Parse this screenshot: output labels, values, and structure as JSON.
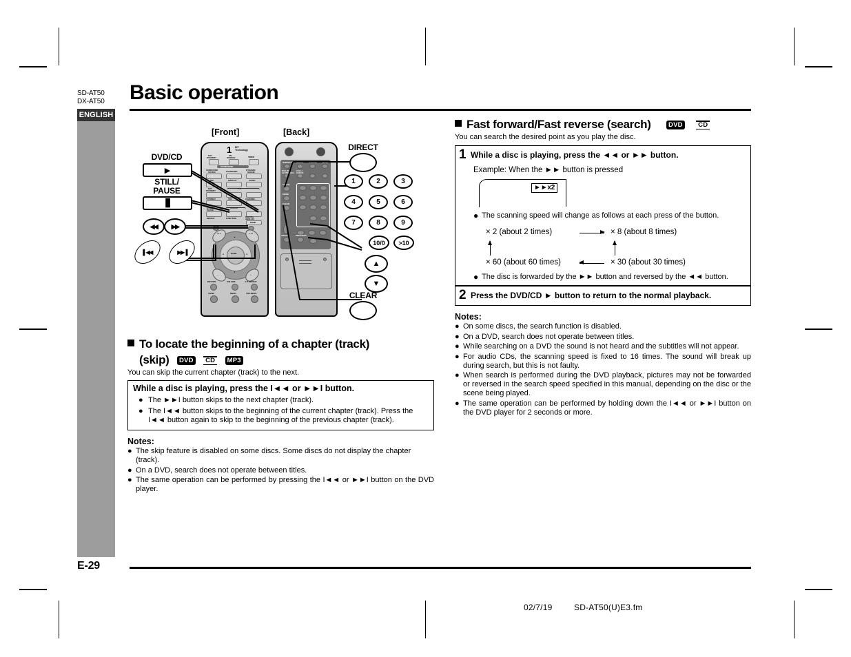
{
  "sidebar": {
    "model_codes": "SD-AT50\nDX-AT50",
    "model_line1": "SD-AT50",
    "model_line2": "DX-AT50",
    "language_tab": "ENGLISH",
    "page_number": "E-29"
  },
  "header": {
    "title": "Basic operation"
  },
  "print_footer": {
    "date": "02/7/19",
    "filename": "SD-AT50(U)E3.fm"
  },
  "remote_diagram": {
    "view_front": "[Front]",
    "view_back": "[Back]",
    "callouts": {
      "dvd_cd": "DVD/CD",
      "still_pause_l1": "STILL/",
      "still_pause_l2": "PAUSE",
      "direct": "DIRECT",
      "clear": "CLEAR"
    },
    "numeric_keys": [
      "1",
      "2",
      "3",
      "4",
      "5",
      "6",
      "7",
      "8",
      "9"
    ],
    "numeric_keys_extra": [
      "10/0",
      ">10"
    ],
    "search_buttons": [
      "◄◄",
      "►►"
    ],
    "skip_buttons": [
      "I◄◄",
      "►►I"
    ],
    "cursor_buttons": [
      "▲",
      "▼"
    ],
    "remote_front_labels": [
      "DAY STANDBY",
      "ON SCREEN",
      "TIMER",
      "SURROUND SOUND",
      "STANDARD",
      "DYNAMIC SOUND",
      "MIC",
      "DISPLAY",
      "AUDIO",
      "DAY STANDBY",
      "T V",
      "TV/VIDEO",
      "VOLUME",
      "CHANNEL",
      "STILL/PAUSE",
      "DVD/CD",
      "REPEAT",
      "FUNCTION",
      "DIGITAL/ ANALOG",
      "BAND",
      "TUNER PRESET",
      "RETURN",
      "VOLUME",
      "A-B REPEAT",
      "ZOOM",
      "MENU",
      "TOP MENU"
    ],
    "remote_back_labels": [
      "SUBTITLE",
      "ANGLE",
      "A.MODE",
      "LEVEL",
      "DIALOG ALT/ RECALL",
      "CALL/ CHECK",
      "CLOCK",
      "MODE",
      "CLEAR",
      "TRACK",
      "PROGRAM",
      "SET/ CLEAR"
    ],
    "one_bit_logo": "1 BIT Technology"
  },
  "left_section": {
    "heading_line1": "To locate the beginning of a chapter (track)",
    "heading_line2": "(skip)",
    "badges": [
      "DVD",
      "CD",
      "MP3"
    ],
    "lead": "You can skip the current chapter (track) to the next.",
    "box": {
      "title": "While a disc is playing, press the I◄◄ or ►►I button.",
      "bullets": [
        "The ►►I button skips to the next chapter (track).",
        "The I◄◄ button skips to the beginning of the current chapter (track). Press the I◄◄ button again to skip to the beginning of the previous chapter (track)."
      ]
    },
    "notes_heading": "Notes:",
    "notes": [
      "The skip feature is disabled on some discs. Some discs do not display the chapter (track).",
      "On a DVD, search does not operate between titles.",
      "The same operation can be performed by pressing the I◄◄ or ►►I button on the DVD player."
    ]
  },
  "right_section": {
    "heading": "Fast forward/Fast reverse (search)",
    "badges": [
      "DVD",
      "CD"
    ],
    "lead": "You can search the desired point as you play the disc.",
    "steps": [
      {
        "number": "1",
        "text": "While a disc is playing, press the ◄◄ or ►► button.",
        "example": "Example: When the ►► button is pressed",
        "screen_indicator": "►►x2",
        "bullet_top": "The scanning speed will change as follows at each press of the button.",
        "bullet_bottom": "The disc is forwarded by the ►► button and reversed by the ◄◄ button."
      },
      {
        "number": "2",
        "text": "Press the DVD/CD ► button to return to the normal playback."
      }
    ],
    "speed_cycle": {
      "top_left": "× 2 (about 2 times)",
      "top_right": "× 8 (about 8 times)",
      "bottom_left": "× 60 (about 60 times)",
      "bottom_right": "× 30 (about 30 times)"
    },
    "notes_heading": "Notes:",
    "notes": [
      "On some discs, the search function is disabled.",
      "On a DVD, search does not operate between titles.",
      "While searching on a DVD the sound is not heard and the subtitles will not appear.",
      "For audio CDs, the scanning speed is fixed to 16 times. The sound will break up during search, but this is not faulty.",
      "When search is performed during the DVD playback, pictures may not be forwarded or reversed in the search speed specified in this manual, depending on the disc or the scene being played.",
      "The same operation can be performed by holding down the I◄◄ or ►►I button on the DVD player for 2 seconds or more."
    ]
  },
  "colors": {
    "lang_tab_bg": "#333333",
    "sidebar_band": "#9d9d9d",
    "text": "#000000",
    "page_bg": "#ffffff"
  }
}
